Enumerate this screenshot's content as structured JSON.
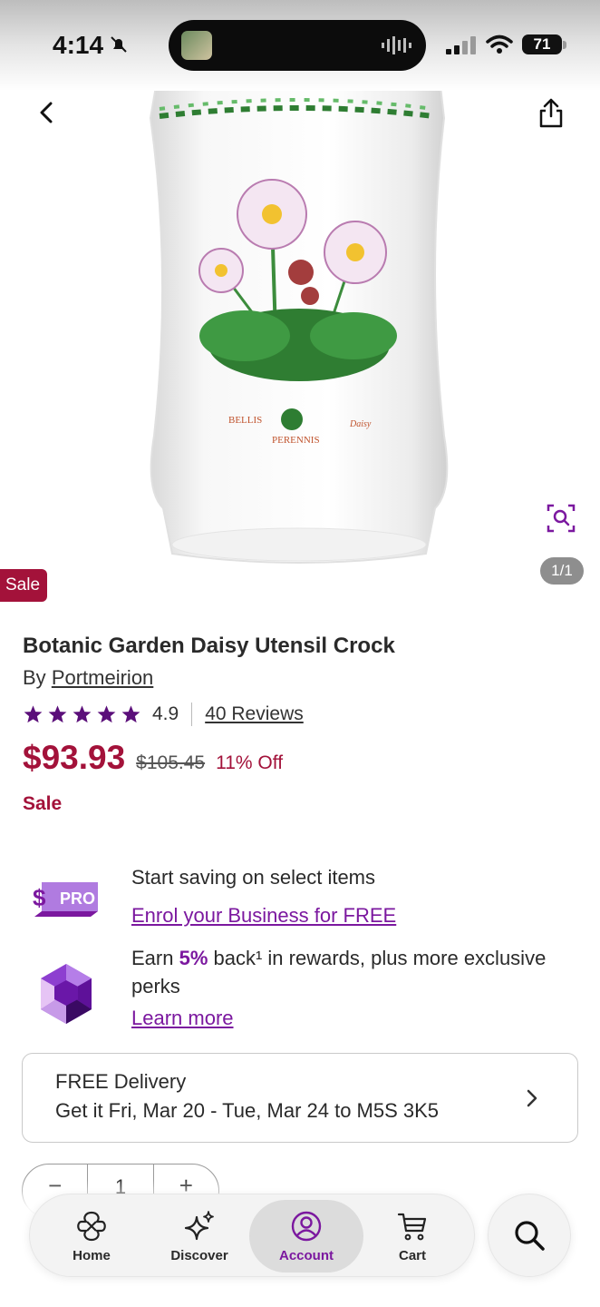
{
  "status_bar": {
    "time": "4:14",
    "battery": "71"
  },
  "hero": {
    "pager": "1/1",
    "sale_tag": "Sale"
  },
  "product": {
    "title": "Botanic Garden Daisy Utensil Crock",
    "by_prefix": "By",
    "brand": "Portmeirion",
    "rating": "4.9",
    "rating_stars": 5,
    "reviews": "40 Reviews",
    "price": "$93.93",
    "old_price": "$105.45",
    "discount": "11% Off",
    "sale_label": "Sale"
  },
  "promo_pro": {
    "logo_text": "PRO",
    "text": "Start saving on select items",
    "link": "Enrol your Business for FREE"
  },
  "promo_rewards": {
    "text_before": "Earn ",
    "highlight": "5%",
    "text_after": " back¹ in rewards, plus more exclusive perks",
    "link": "Learn more"
  },
  "delivery": {
    "title": "FREE Delivery",
    "date": "Get it Fri, Mar 20 - Tue, Mar 24 to M5S 3K5"
  },
  "quantity": {
    "minus": "−",
    "value": "1",
    "plus": "+"
  },
  "nav": {
    "items": [
      {
        "label": "Home",
        "icon": "home-icon"
      },
      {
        "label": "Discover",
        "icon": "sparkle-icon"
      },
      {
        "label": "Account",
        "icon": "account-icon",
        "active": true
      },
      {
        "label": "Cart",
        "icon": "cart-icon"
      }
    ],
    "search_icon": "search-icon"
  },
  "colors": {
    "accent_purple": "#7b189f",
    "sale_red": "#a3123a",
    "star_purple": "#5b0f7a"
  }
}
